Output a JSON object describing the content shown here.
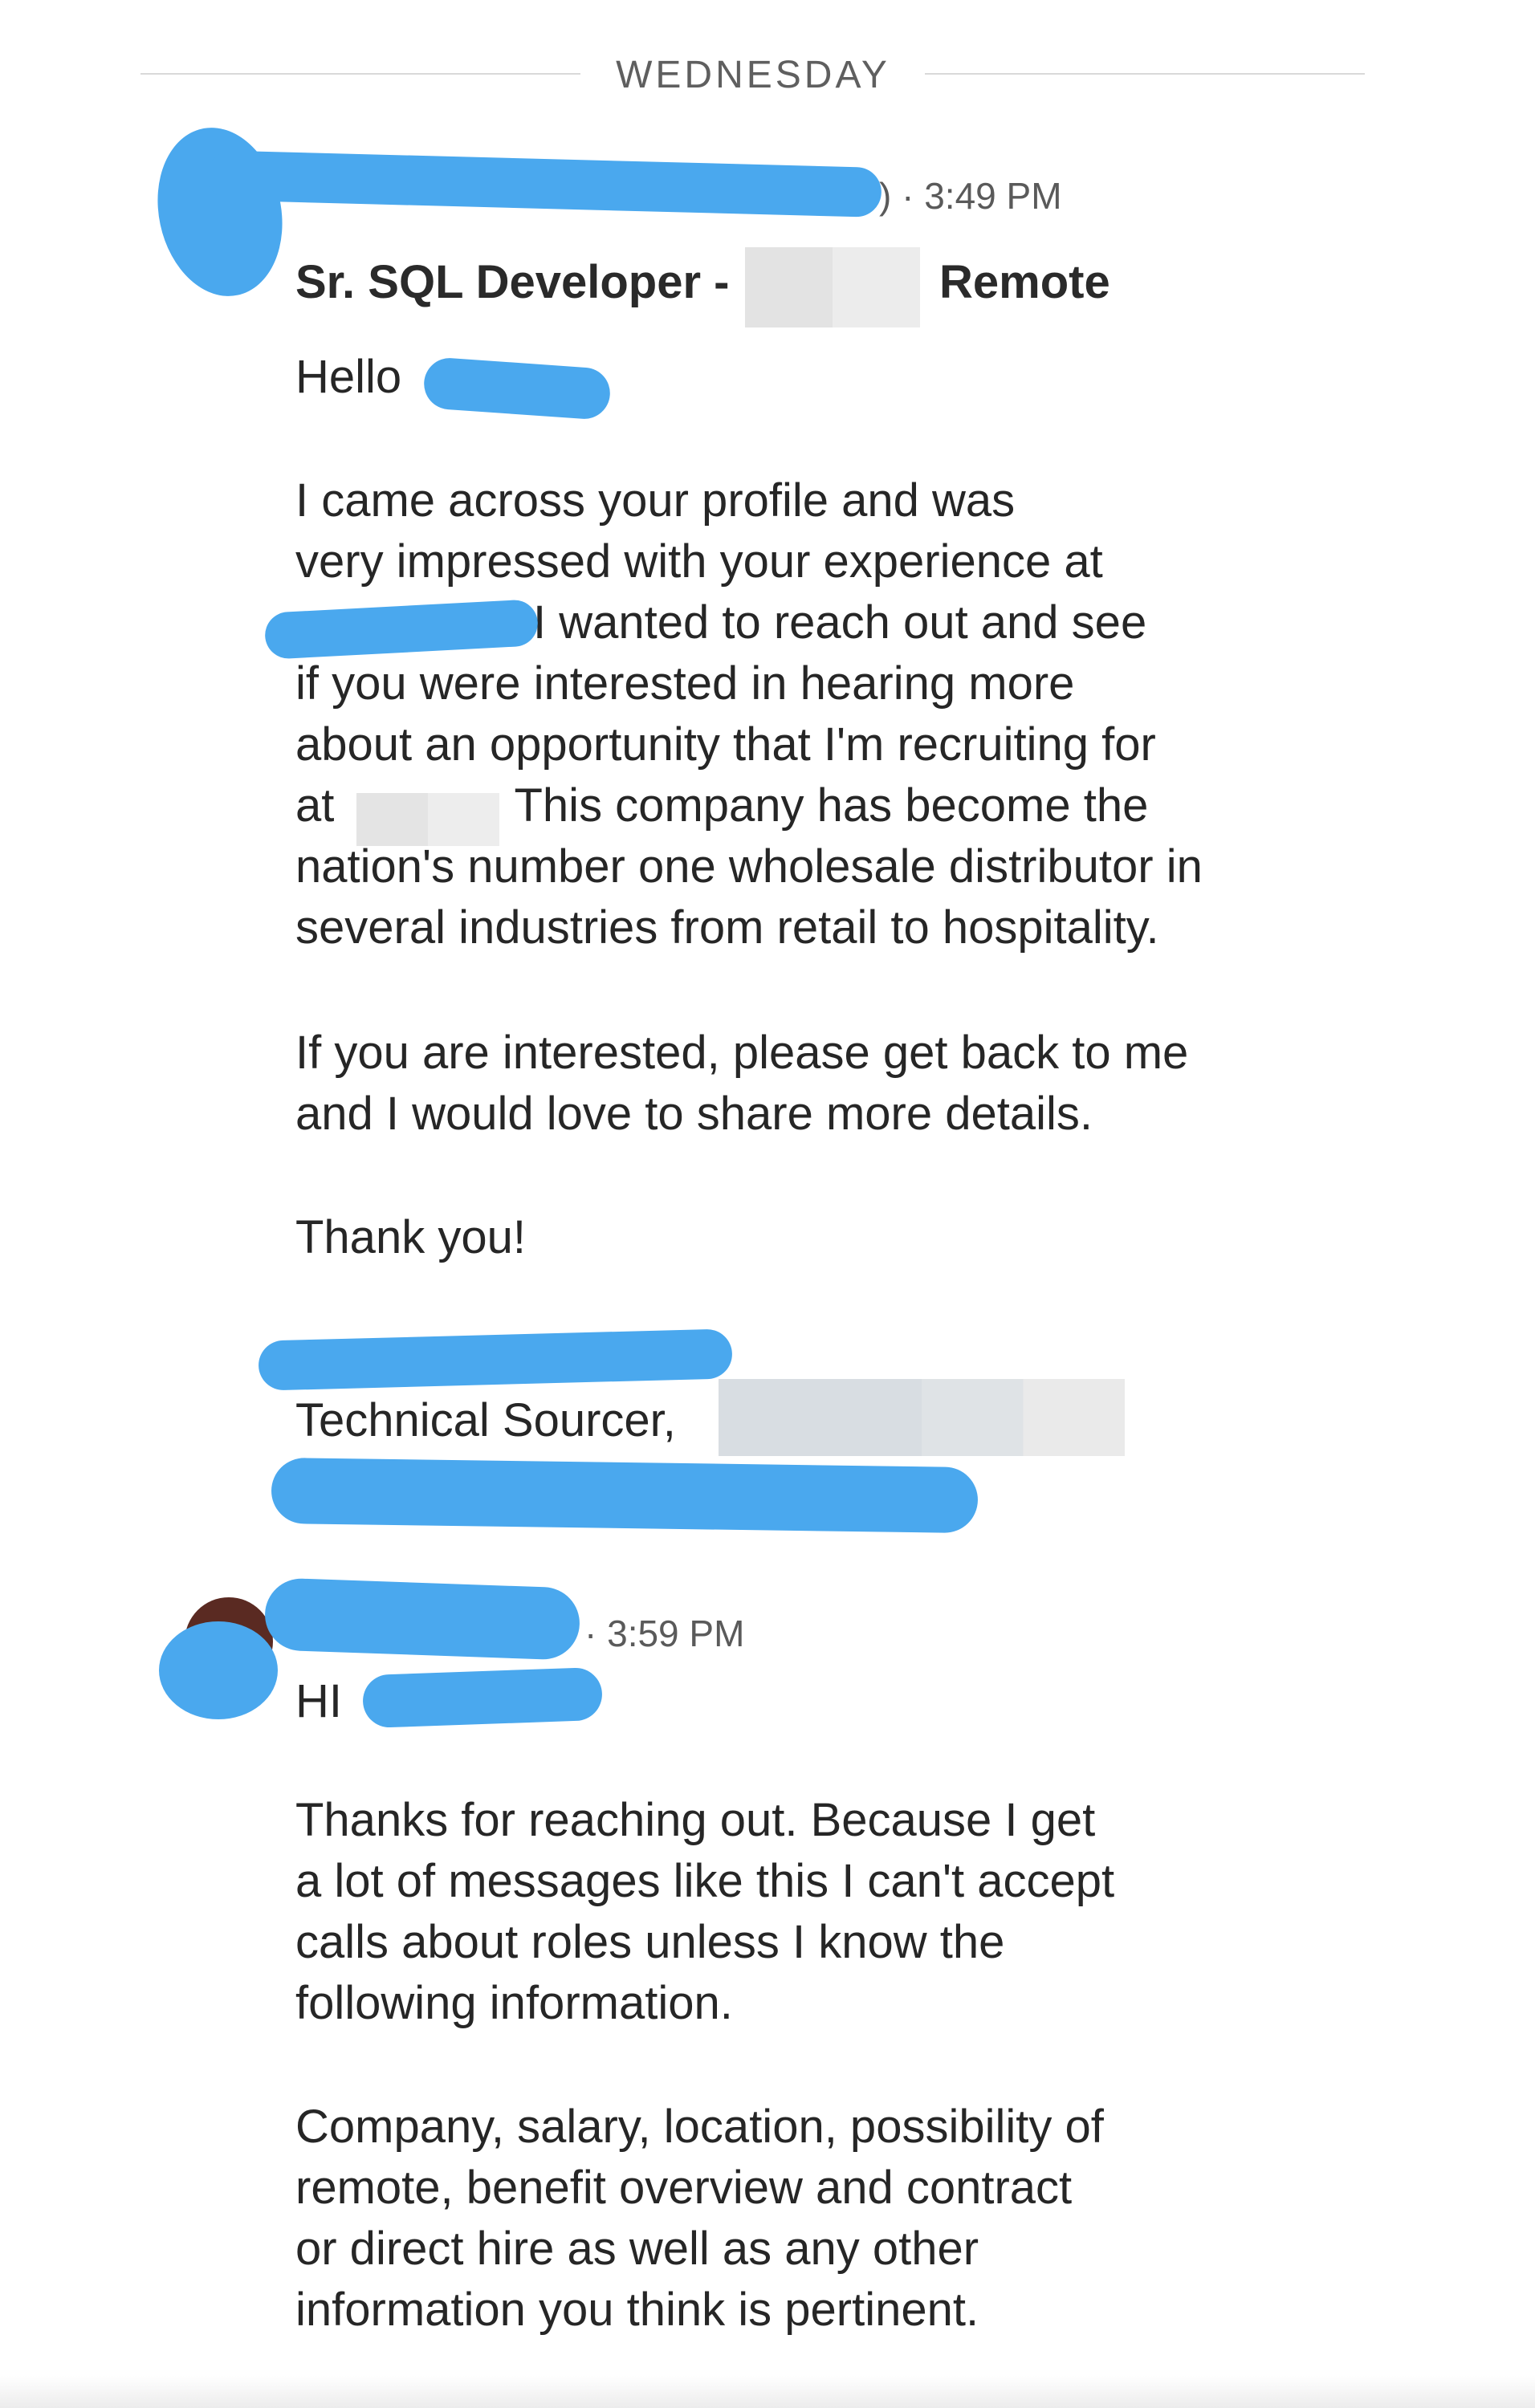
{
  "divider": {
    "label": "WEDNESDAY"
  },
  "messages": [
    {
      "time": "3:49 PM",
      "subject_prefix": "Sr. SQL Developer -",
      "subject_suffix": "Remote",
      "greeting": "Hello",
      "body1": [
        "I came across your profile and was",
        "very impressed with your experience at",
        "I wanted to reach out and see",
        "if you were interested in hearing more",
        "about an opportunity that I'm recruiting for",
        "at",
        "This company has become the",
        "nation's number one wholesale distributor in",
        "several industries from retail to hospitality."
      ],
      "body2": [
        "If you are interested, please get back to me",
        "and I would love to share more details."
      ],
      "closing": "Thank you!",
      "signature_title": "Technical Sourcer,"
    },
    {
      "time": "3:59 PM",
      "greeting": "HI",
      "body1": [
        "Thanks for reaching out. Because I get",
        "a lot of messages like this I can't accept",
        "calls about roles unless I know the",
        "following information."
      ],
      "body2": [
        "Company, salary, location, possibility of",
        "remote, benefit overview and contract",
        "or direct hire as well as any other",
        "information you think is pertinent."
      ]
    }
  ],
  "colors": {
    "redaction_blue": "#4aa8ee",
    "redaction_grey": "#dde0e4"
  }
}
